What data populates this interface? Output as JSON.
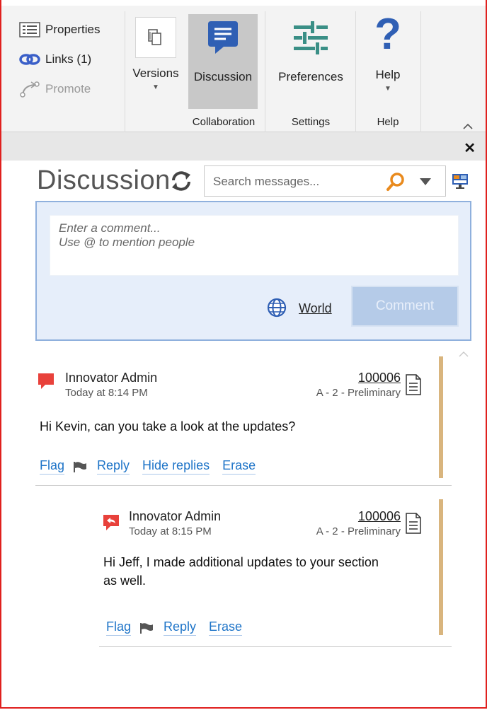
{
  "ribbon": {
    "properties_label": "Properties",
    "links_label": "Links (1)",
    "promote_label": "Promote",
    "versions_label": "Versions",
    "discussion_label": "Discussion",
    "preferences_label": "Preferences",
    "help_label": "Help",
    "group_collaboration": "Collaboration",
    "group_settings": "Settings",
    "group_help": "Help"
  },
  "pane": {
    "title": "Discussion",
    "close_glyph": "✕",
    "search_placeholder": "Search messages..."
  },
  "compose": {
    "placeholder": "Enter a comment...\nUse @ to mention people",
    "visibility_label": "World",
    "submit_label": "Comment"
  },
  "messages": [
    {
      "author": "Innovator Admin",
      "time": "Today at 8:14 PM",
      "item_number": "100006",
      "item_revision": "A - 2 - Preliminary",
      "text": "Hi Kevin, can you take a look at the updates?",
      "actions": {
        "flag": "Flag",
        "reply": "Reply",
        "hide_replies": "Hide replies",
        "erase": "Erase"
      }
    },
    {
      "author": "Innovator Admin",
      "time": "Today at 8:15 PM",
      "item_number": "100006",
      "item_revision": "A - 2 - Preliminary",
      "text": "Hi Jeff, I made additional updates to your section as well.",
      "actions": {
        "flag": "Flag",
        "reply": "Reply",
        "erase": "Erase"
      }
    }
  ],
  "colors": {
    "accent_blue": "#2f5fb4",
    "preferences_teal": "#3a8f86",
    "comment_red": "#e8413b",
    "link_blue": "#1e74c8",
    "thread_bar": "#d9b57e",
    "search_orange": "#e98a1d"
  }
}
